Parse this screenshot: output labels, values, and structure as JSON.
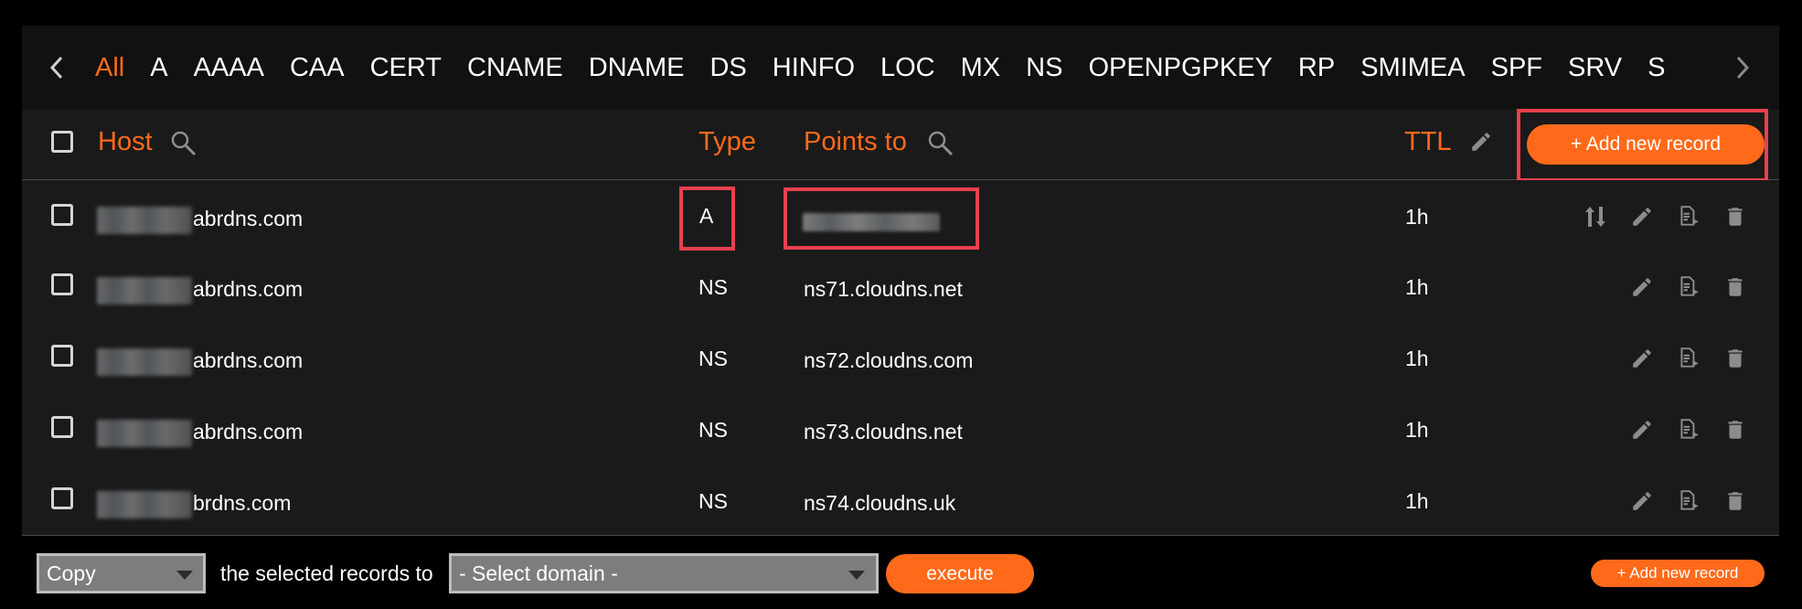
{
  "tabs": [
    "All",
    "A",
    "AAAA",
    "CAA",
    "CERT",
    "CNAME",
    "DNAME",
    "DS",
    "HINFO",
    "LOC",
    "MX",
    "NS",
    "OPENPGPKEY",
    "RP",
    "SMIMEA",
    "SPF",
    "SRV",
    "S"
  ],
  "header": {
    "host": "Host",
    "type": "Type",
    "points_to": "Points to",
    "ttl": "TTL",
    "add_new_record": "+ Add new record"
  },
  "rows": [
    {
      "host_suffix": "abrdns.com",
      "type": "A",
      "points_to": "",
      "ttl": "1h"
    },
    {
      "host_suffix": "abrdns.com",
      "type": "NS",
      "points_to": "ns71.cloudns.net",
      "ttl": "1h"
    },
    {
      "host_suffix": "abrdns.com",
      "type": "NS",
      "points_to": "ns72.cloudns.com",
      "ttl": "1h"
    },
    {
      "host_suffix": "abrdns.com",
      "type": "NS",
      "points_to": "ns73.cloudns.net",
      "ttl": "1h"
    },
    {
      "host_suffix": "brdns.com",
      "type": "NS",
      "points_to": "ns74.cloudns.uk",
      "ttl": "1h"
    }
  ],
  "bottom": {
    "action_value": "Copy",
    "selected_text": "the selected records to",
    "domain_value": "- Select domain -",
    "execute": "execute",
    "add_new_record": "+ Add new record"
  },
  "colors": {
    "accent": "#ff6a1a",
    "highlight": "#e8404e",
    "row_bg": "#1a1a1a"
  }
}
